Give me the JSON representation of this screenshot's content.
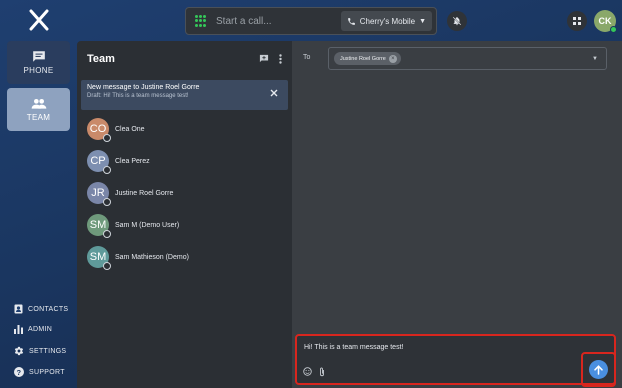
{
  "topbar": {
    "call_placeholder": "Start a call...",
    "carrier": "Cherry's Mobile",
    "user_initials": "CK"
  },
  "nav": {
    "phone_label": "PHONE",
    "team_label": "TEAM",
    "contacts_label": "CONTACTS",
    "admin_label": "ADMIN",
    "settings_label": "SETTINGS",
    "support_label": "SUPPORT"
  },
  "team": {
    "title": "Team",
    "draft_title": "New message to Justine Roel Gorre",
    "draft_preview": "Draft: Hi! This is a team message test!",
    "contacts": [
      {
        "initials": "CO",
        "name": "Clea One",
        "color": "#c98a6a"
      },
      {
        "initials": "CP",
        "name": "Clea Perez",
        "color": "#7d8fb0"
      },
      {
        "initials": "JR",
        "name": "Justine Roel Gorre",
        "color": "#7a86a8"
      },
      {
        "initials": "SM",
        "name": "Sam M (Demo User)",
        "color": "#6f9a7c"
      },
      {
        "initials": "SM",
        "name": "Sam Mathieson (Demo)",
        "color": "#5f9a9a"
      }
    ]
  },
  "conversation": {
    "to_label": "To",
    "recipient": "Justine Roel Gorre",
    "message": "Hi! This is a team message test!"
  },
  "colors": {
    "accent": "#4a8fe0",
    "highlight": "#d8261e",
    "status_green": "#34c759"
  }
}
